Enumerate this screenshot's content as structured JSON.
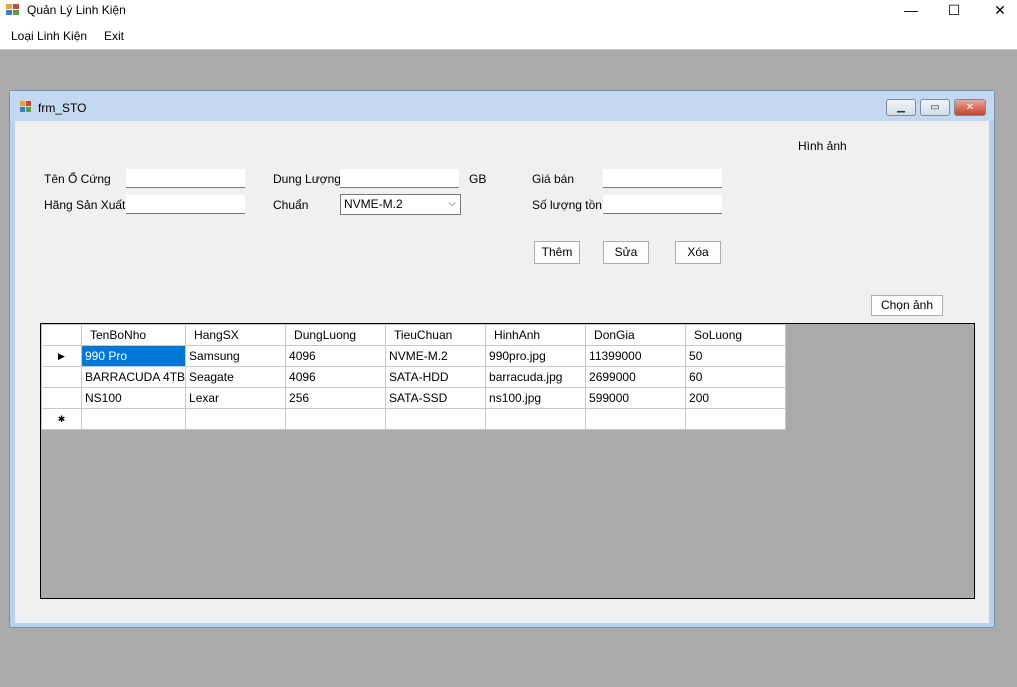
{
  "app": {
    "title": "Quản Lý Linh Kiện",
    "minimize_glyph": "—",
    "maximize_glyph": "☐",
    "close_glyph": "✕"
  },
  "menu": {
    "items": [
      {
        "label": "Loại Linh Kiện"
      },
      {
        "label": "Exit"
      }
    ]
  },
  "child_window": {
    "title": "frm_STO",
    "minimize_glyph": "▁",
    "maximize_glyph": "▭",
    "close_glyph": "✕"
  },
  "form": {
    "labels": {
      "ten_o_cung": "Tên Ổ Cứng",
      "hang_san_xuat": "Hãng Sản Xuất",
      "dung_luong": "Dung Lượng",
      "gb_unit": "GB",
      "chuan": "Chuẩn",
      "gia_ban": "Giá bán",
      "so_luong_ton": "Số lượng tồn",
      "hinh_anh": "Hình ảnh"
    },
    "values": {
      "ten_o_cung": "",
      "hang_san_xuat": "",
      "dung_luong": "",
      "chuan": "NVME-M.2",
      "gia_ban": "",
      "so_luong_ton": ""
    },
    "buttons": {
      "them": "Thêm",
      "sua": "Sửa",
      "xoa": "Xóa",
      "chon_anh": "Chọn ảnh"
    }
  },
  "grid": {
    "columns": [
      "TenBoNho",
      "HangSX",
      "DungLuong",
      "TieuChuan",
      "HinhAnh",
      "DonGia",
      "SoLuong"
    ],
    "rows": [
      [
        "990 Pro",
        "Samsung",
        "4096",
        "NVME-M.2",
        "990pro.jpg",
        "11399000",
        "50"
      ],
      [
        "BARRACUDA 4TB",
        "Seagate",
        "4096",
        "SATA-HDD",
        "barracuda.jpg",
        "2699000",
        "60"
      ],
      [
        "NS100",
        "Lexar",
        "256",
        "SATA-SSD",
        "ns100.jpg",
        "599000",
        "200"
      ]
    ],
    "current_row_glyph": "▶",
    "new_row_glyph": "✱"
  }
}
